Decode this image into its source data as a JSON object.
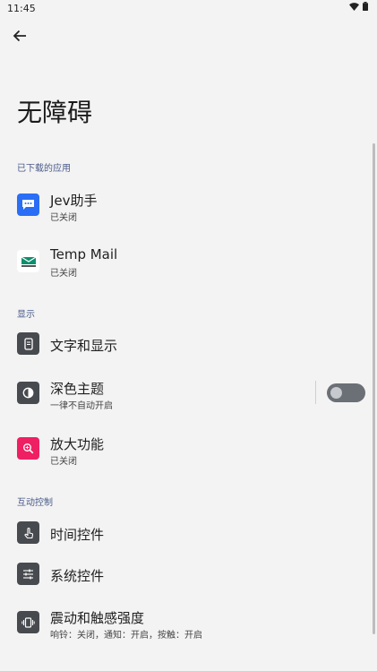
{
  "status_bar": {
    "time": "11:45",
    "wifi_icon": "wifi-icon",
    "battery_icon": "battery-icon"
  },
  "nav": {
    "back_icon": "arrow-back-icon"
  },
  "page": {
    "title": "无障碍"
  },
  "sections": {
    "downloaded_apps": {
      "header": "已下载的应用",
      "items": [
        {
          "title": "Jev助手",
          "subtitle": "已关闭",
          "icon": "chat-bubble-icon"
        },
        {
          "title": "Temp Mail",
          "subtitle": "已关闭",
          "icon": "mail-icon"
        }
      ]
    },
    "display": {
      "header": "显示",
      "items": [
        {
          "title": "文字和显示",
          "icon": "phone-text-icon"
        },
        {
          "title": "深色主题",
          "subtitle": "一律不自动开启",
          "icon": "contrast-icon",
          "toggle_on": false
        },
        {
          "title": "放大功能",
          "subtitle": "已关闭",
          "icon": "magnify-icon"
        }
      ]
    },
    "interaction": {
      "header": "互动控制",
      "items": [
        {
          "title": "时间控件",
          "icon": "touch-timer-icon"
        },
        {
          "title": "系统控件",
          "icon": "sliders-icon"
        },
        {
          "title": "震动和触感强度",
          "subtitle": "响铃：关闭，通知：开启，按触：开启",
          "icon": "vibration-icon"
        }
      ]
    }
  },
  "colors": {
    "background": "#f3f3f3",
    "section_header": "#4a5b8a",
    "icon_dark": "#474a4f",
    "icon_blue": "#2a6ef5",
    "icon_pink": "#ef1f63"
  }
}
